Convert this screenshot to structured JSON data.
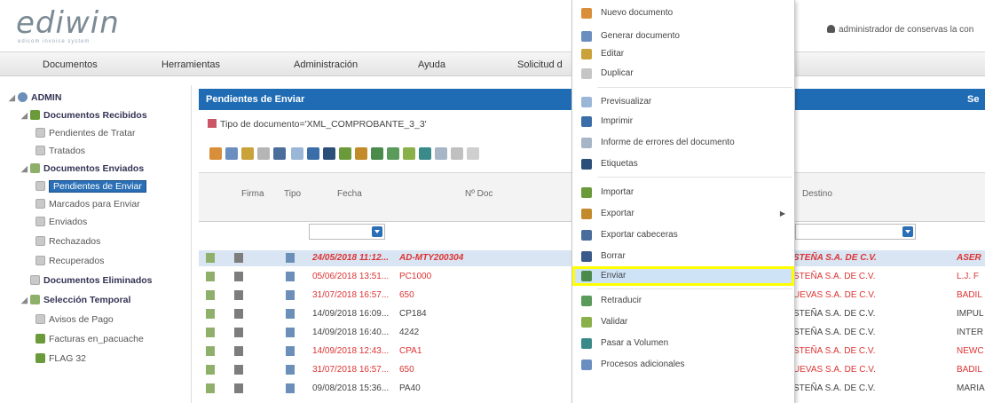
{
  "app": {
    "logo": "ediwin",
    "logo_sub": "edicom invoice system",
    "user": "administrador de conservas la con"
  },
  "menubar": [
    "Documentos",
    "Herramientas",
    "Administración",
    "Ayuda",
    "Solicitud d"
  ],
  "sidebar": {
    "root": "ADMIN",
    "items": [
      {
        "label": "Documentos Recibidos",
        "type": "group"
      },
      {
        "label": "Pendientes de Tratar",
        "type": "leaf"
      },
      {
        "label": "Tratados",
        "type": "leaf"
      },
      {
        "label": "Documentos Enviados",
        "type": "group"
      },
      {
        "label": "Pendientes de Enviar",
        "type": "leaf",
        "selected": true
      },
      {
        "label": "Marcados para Enviar",
        "type": "leaf"
      },
      {
        "label": "Enviados",
        "type": "leaf"
      },
      {
        "label": "Rechazados",
        "type": "leaf"
      },
      {
        "label": "Recuperados",
        "type": "leaf"
      },
      {
        "label": "Documentos Eliminados",
        "type": "group"
      },
      {
        "label": "Selección Temporal",
        "type": "group"
      },
      {
        "label": "Avisos de Pago",
        "type": "leaf"
      },
      {
        "label": "Facturas en_pacuache",
        "type": "leaf"
      },
      {
        "label": "FLAG 32",
        "type": "leaf"
      }
    ]
  },
  "panel": {
    "title": "Pendientes de Enviar",
    "title_right": "Se",
    "filter": "Tipo de documento='XML_COMPROBANTE_3_3'"
  },
  "grid": {
    "columns": [
      "Firma",
      "Tipo",
      "Fecha",
      "Nº Doc",
      "Destino"
    ],
    "rows": [
      {
        "fecha": "24/05/2018 11:12...",
        "doc": "AD-MTY200304",
        "destino": "STEÑA S.A. DE C.V.",
        "extra": "ASER",
        "style": "red-bold"
      },
      {
        "fecha": "05/06/2018 13:51...",
        "doc": "PC1000",
        "destino": "STEÑA S.A. DE C.V.",
        "extra": "L.J. F",
        "style": "red"
      },
      {
        "fecha": "31/07/2018 16:57...",
        "doc": "650",
        "destino": "UEVAS S.A. DE C.V.",
        "extra": "BADIL",
        "style": "red"
      },
      {
        "fecha": "14/09/2018 16:09...",
        "doc": "CP184",
        "destino": "STEÑA S.A. DE C.V.",
        "extra": "IMPUL",
        "style": "dark"
      },
      {
        "fecha": "14/09/2018 16:40...",
        "doc": "4242",
        "destino": "STEÑA S.A. DE C.V.",
        "extra": "INTER",
        "style": "dark"
      },
      {
        "fecha": "14/09/2018 12:43...",
        "doc": "CPA1",
        "destino": "STEÑA S.A. DE C.V.",
        "extra": "NEWC",
        "style": "red"
      },
      {
        "fecha": "31/07/2018 16:57...",
        "doc": "650",
        "destino": "UEVAS S.A. DE C.V.",
        "extra": "BADIL",
        "style": "red"
      },
      {
        "fecha": "09/08/2018 15:36...",
        "doc": "PA40",
        "destino": "STEÑA S.A. DE C.V.",
        "extra": "MARIA",
        "style": "dark"
      }
    ]
  },
  "context_menu": [
    "Nuevo documento",
    "Generar documento",
    "Editar",
    "Duplicar",
    "Previsualizar",
    "Imprimir",
    "Informe de errores del documento",
    "Etiquetas",
    "Importar",
    "Exportar",
    "Exportar cabeceras",
    "Borrar",
    "Enviar",
    "Retraducir",
    "Validar",
    "Pasar a Volumen",
    "Procesos adicionales"
  ],
  "colors": {
    "accent": "#1f6cb5",
    "highlight_outline": "#ffff00",
    "error_text": "#dd3333"
  }
}
